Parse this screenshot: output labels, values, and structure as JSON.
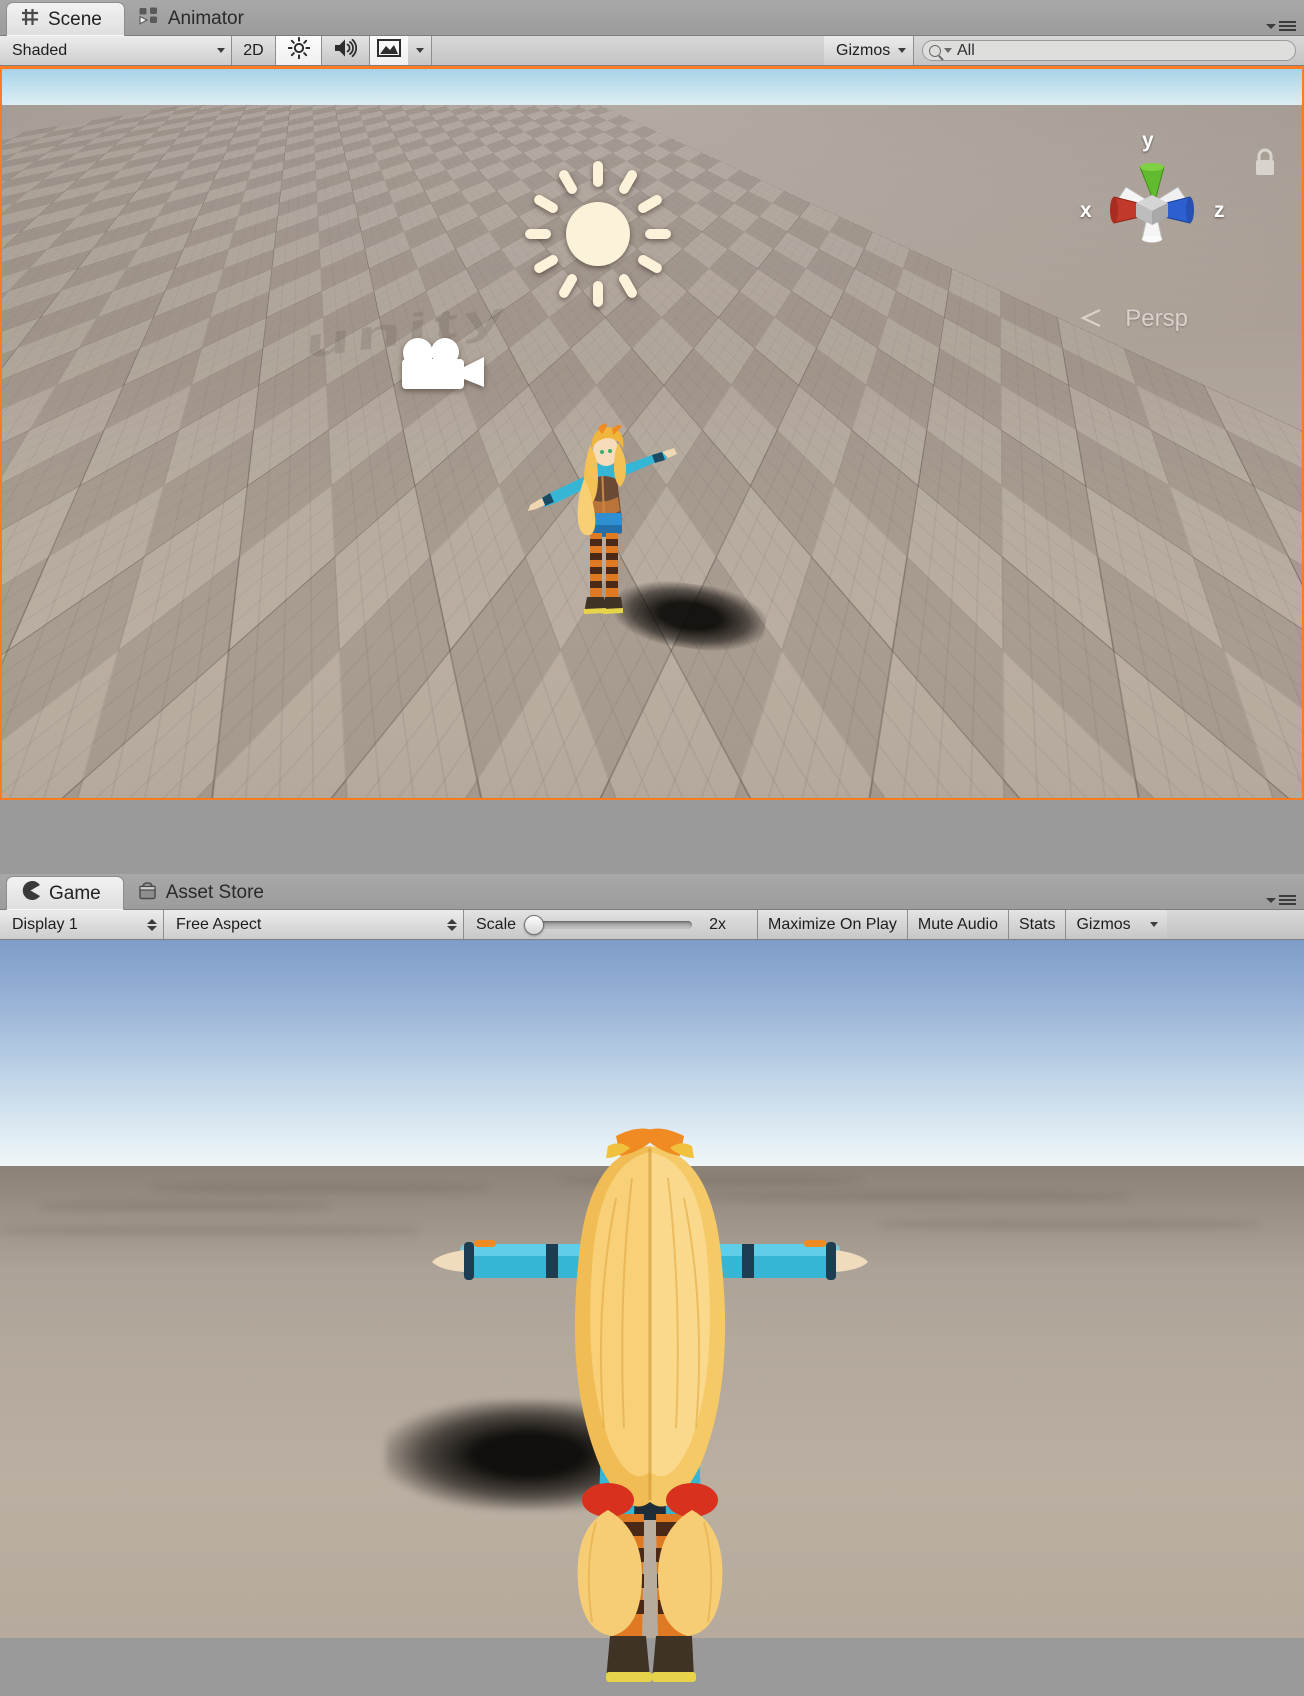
{
  "scene_panel": {
    "tabs": [
      {
        "label": "Scene",
        "icon": "grid-icon",
        "active": true
      },
      {
        "label": "Animator",
        "icon": "animator-nodes-icon",
        "active": false
      }
    ],
    "toolbar": {
      "draw_mode": "Shaded",
      "mode_2d": "2D",
      "lighting_icon": "sun-lighting-icon",
      "audio_icon": "speaker-icon",
      "effects_icon": "image-effects-icon",
      "effects_caret": "chevron-down-icon",
      "gizmos_label": "Gizmos",
      "search_placeholder": "All",
      "search_value": "All",
      "search_icon": "search-icon"
    },
    "viewport": {
      "watermark": "unity",
      "axis_gizmo": {
        "x_label": "x",
        "y_label": "y",
        "z_label": "z",
        "x_color": "#c0392b",
        "y_color": "#62bb2e",
        "z_color": "#2c5fd0",
        "neutral_color": "#e8e8e8"
      },
      "projection_label": "Persp",
      "lock_icon": "lock-icon",
      "light_gizmo": "directional-light-icon",
      "camera_gizmo": "camera-icon",
      "selection_outline_color": "#ff7b21"
    }
  },
  "game_panel": {
    "tabs": [
      {
        "label": "Game",
        "icon": "game-pacman-icon",
        "active": true
      },
      {
        "label": "Asset Store",
        "icon": "shopping-bag-icon",
        "active": false
      }
    ],
    "toolbar": {
      "display": "Display 1",
      "aspect": "Free Aspect",
      "scale_label": "Scale",
      "scale_value": "2x",
      "scale_percent": 2,
      "maximize_on_play": "Maximize On Play",
      "mute_audio": "Mute Audio",
      "stats": "Stats",
      "gizmos": "Gizmos"
    }
  }
}
